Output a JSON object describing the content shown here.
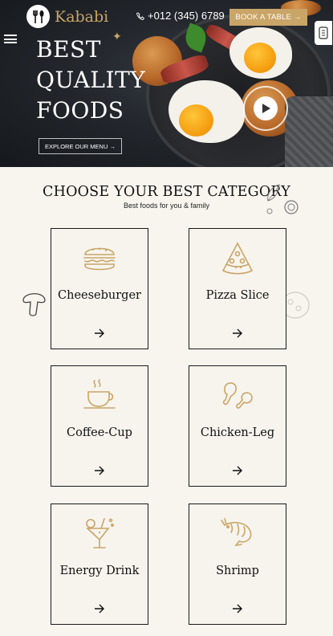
{
  "header": {
    "brand": "Kababi",
    "phone": "+012 (345) 6789",
    "book_label": "BOOK A TABLE →"
  },
  "hero": {
    "title_line1": "BEST",
    "title_line2": "QUALITY",
    "title_line3": "FOODS",
    "explore_label": "EXPLORE OUR MENU →"
  },
  "section": {
    "title": "CHOOSE YOUR BEST CATEGORY",
    "subtitle": "Best foods for you & family"
  },
  "categories": [
    {
      "label": "Cheeseburger",
      "icon": "burger-icon"
    },
    {
      "label": "Pizza Slice",
      "icon": "pizza-icon"
    },
    {
      "label": "Coffee-Cup",
      "icon": "coffee-cup-icon"
    },
    {
      "label": "Chicken-Leg",
      "icon": "chicken-leg-icon"
    },
    {
      "label": "Energy Drink",
      "icon": "cocktail-icon"
    },
    {
      "label": "Shrimp",
      "icon": "shrimp-icon"
    }
  ],
  "colors": {
    "accent": "#c9a567",
    "hero_bg": "#24282e",
    "page_bg": "#f7f4ee"
  }
}
